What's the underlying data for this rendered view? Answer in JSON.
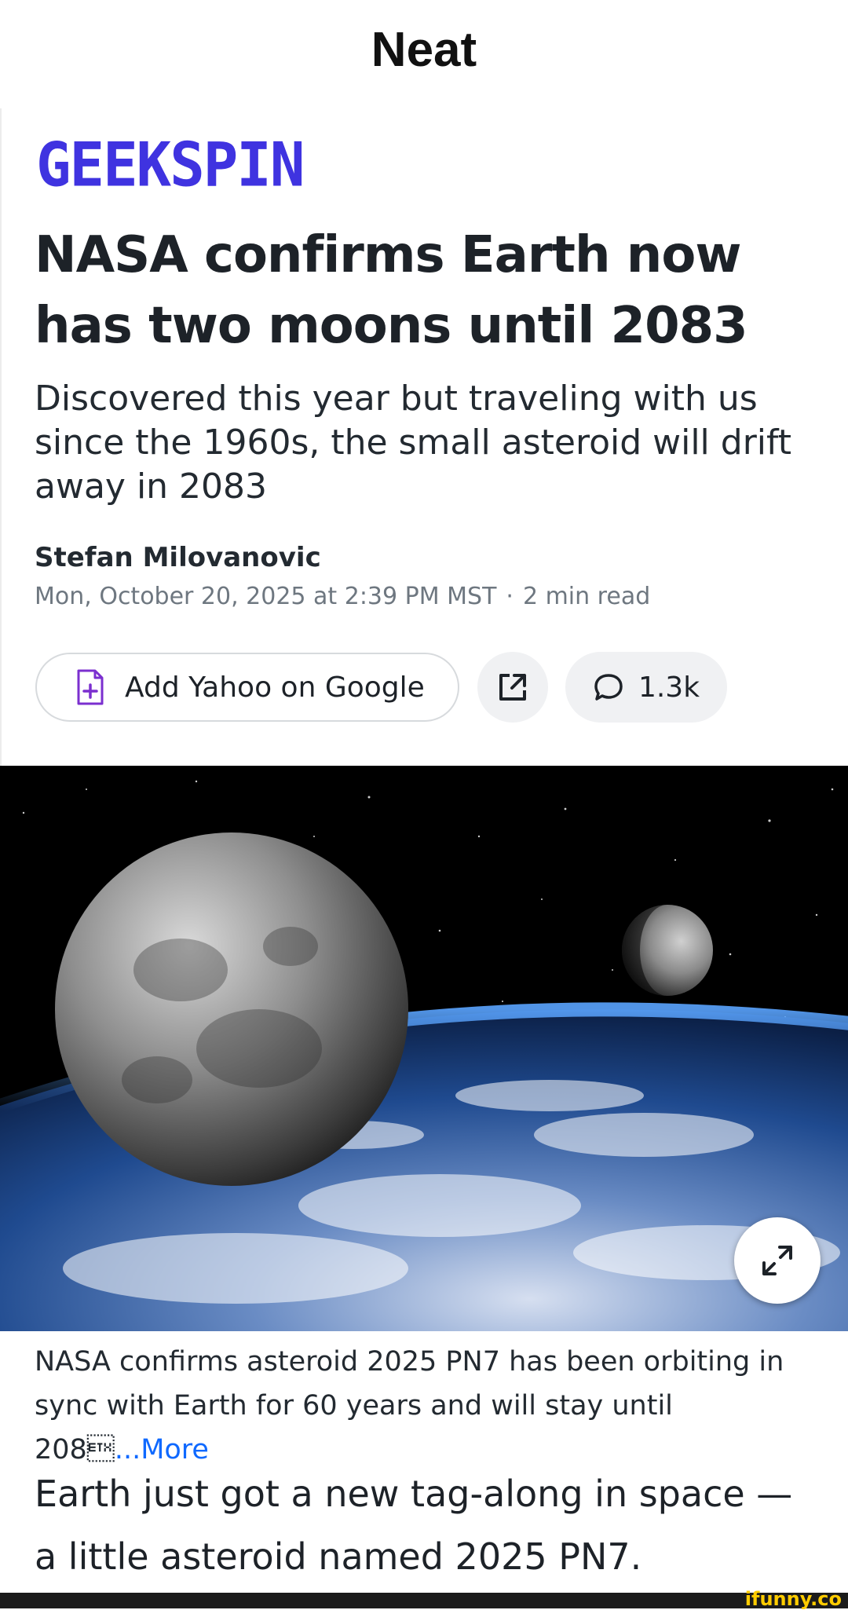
{
  "post": {
    "title": "Neat"
  },
  "article": {
    "brand": "GEEKSPIN",
    "headline": "NASA confirms Earth now has two moons until 2083",
    "subheadline": "Discovered this year but traveling with us since the 1960s, the small asteroid will drift away in 2083",
    "author": "Stefan Milovanovic",
    "date": "Mon, October 20, 2025 at 2:39 PM MST",
    "separator": "·",
    "read_time": "2 min read",
    "actions": {
      "add_google_label": "Add Yahoo on Google",
      "comments_count": "1.3k"
    },
    "image": {
      "alt": "Moon and a small second moon above Earth",
      "caption_text": "NASA confirms asteroid 2025 PN7 has been orbiting in sync with Earth for 60 years and will stay until 208\u0003",
      "caption_more": "...More"
    },
    "body_first_paragraph": "Earth just got a new tag-along in space — a little asteroid named 2025 PN7."
  },
  "watermark": "ifunny.co",
  "colors": {
    "brand": "#3f33e0",
    "link": "#0f69ff",
    "google_icon": "#7b2fcf"
  }
}
